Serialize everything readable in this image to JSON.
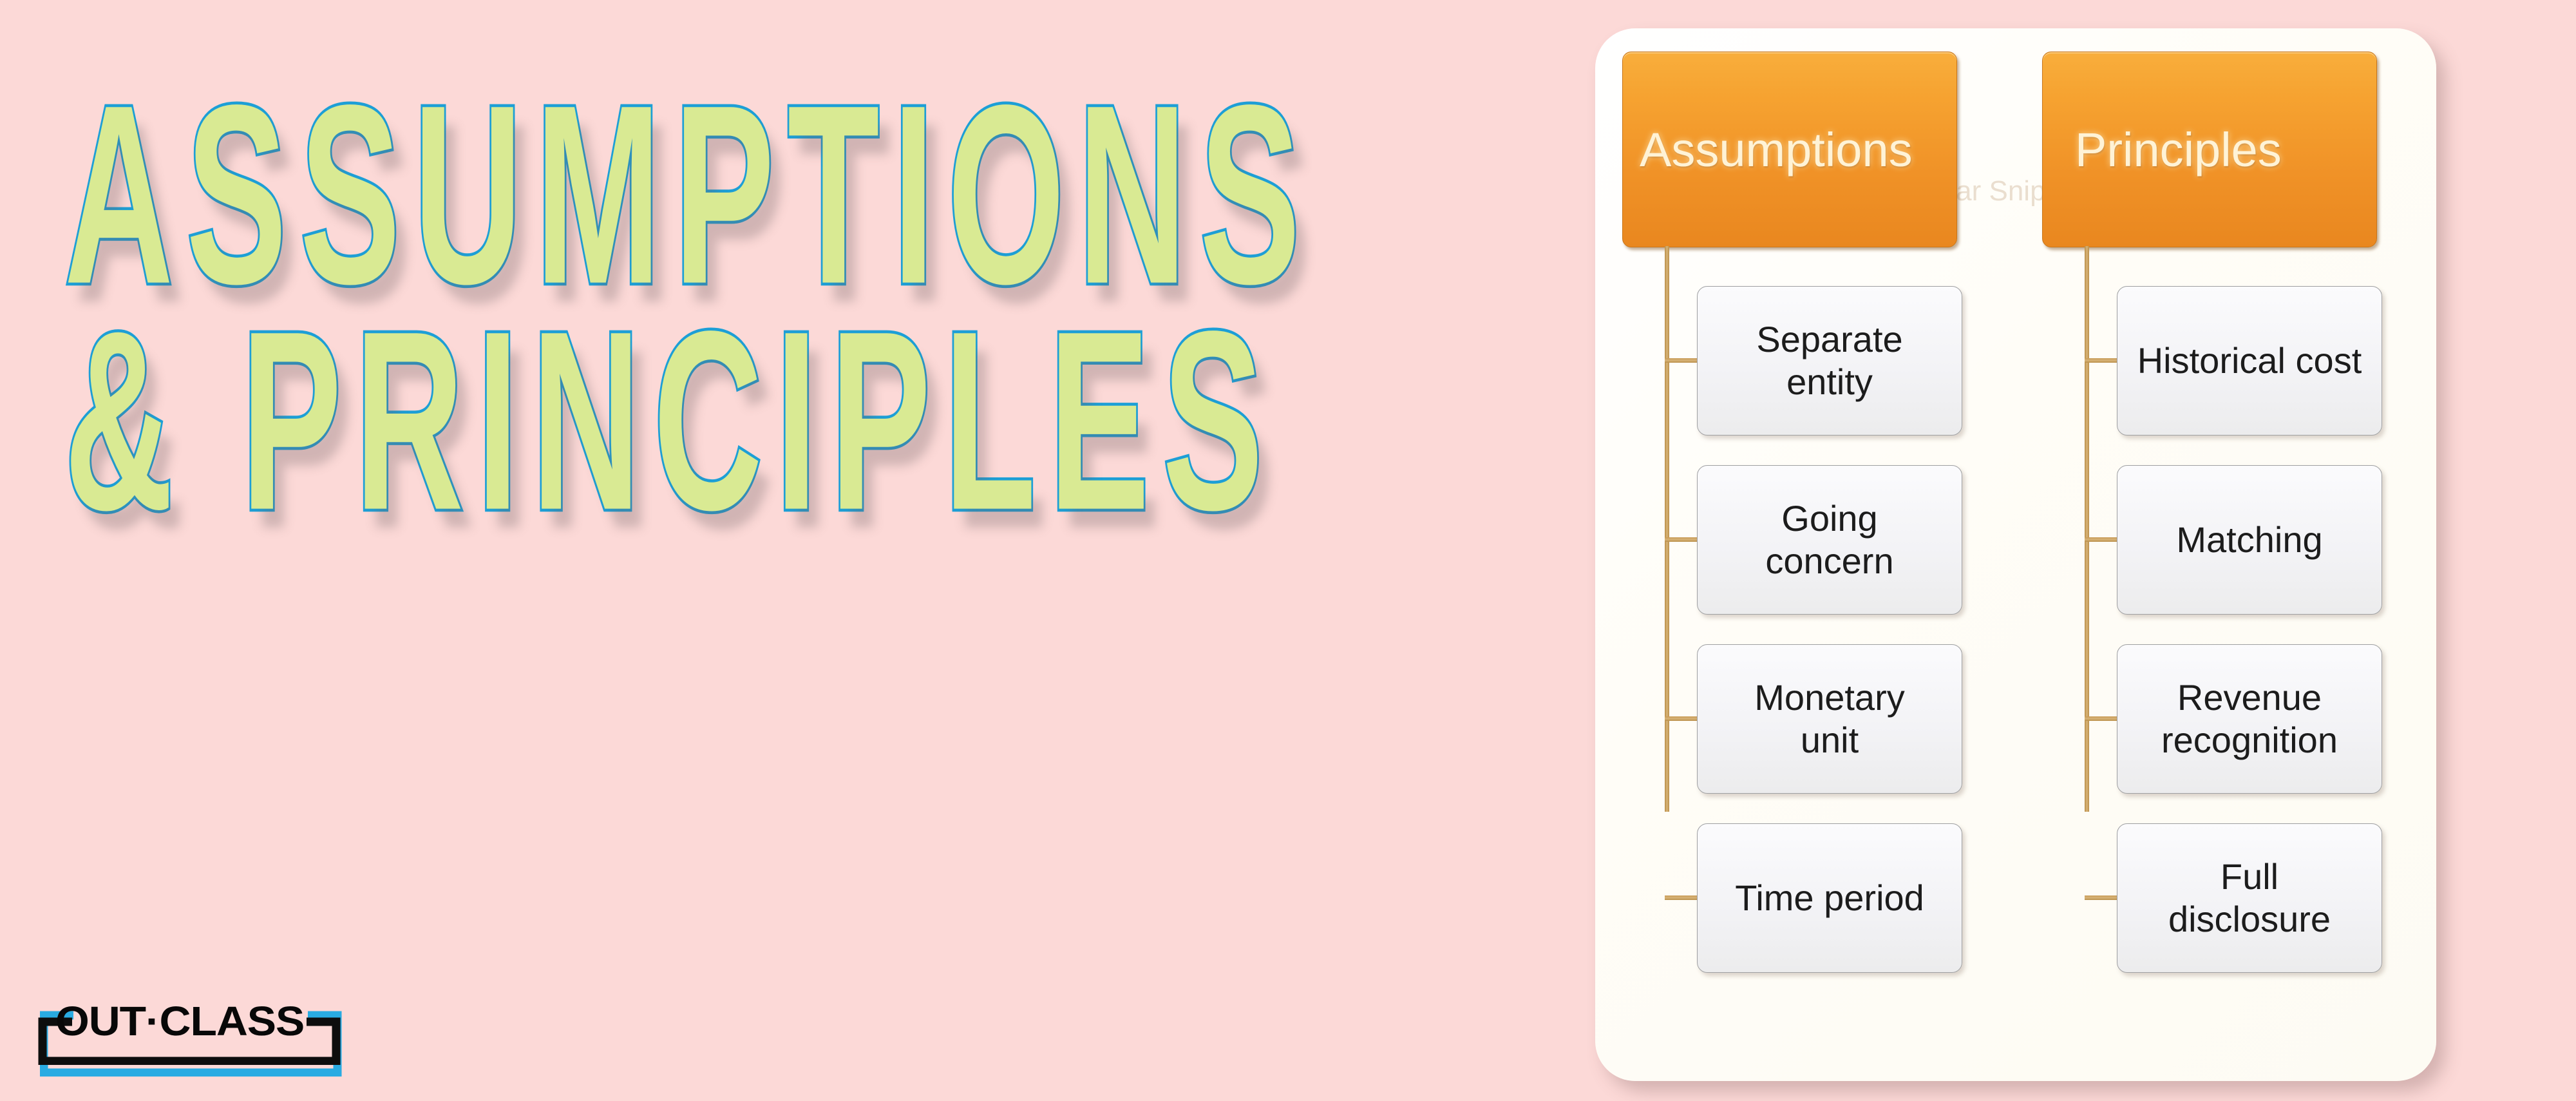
{
  "page": {
    "background_color": "#fcd9d7"
  },
  "title": {
    "line1": "ASSUMPTIONS",
    "line2": "& PRINCIPLES",
    "fill_color": "#d9ea93",
    "outline_color": "#1d9fd6"
  },
  "logo": {
    "word": "OUT·CLASS",
    "bracket_color_primary": "#0d0d0d",
    "bracket_color_accent": "#29abe2"
  },
  "diagram": {
    "card_background": "#ffffff",
    "header_color": "#f09227",
    "header_text_color": "#fff3d6",
    "connector_color": "#c69a56",
    "watermark": "Rectangular Snip",
    "columns": [
      {
        "header": "Assumptions",
        "items": [
          {
            "line1": "Separate",
            "line2": "entity"
          },
          {
            "line1": "Going",
            "line2": "concern"
          },
          {
            "line1": "Monetary",
            "line2": "unit"
          },
          {
            "line1": "Time period",
            "line2": ""
          }
        ]
      },
      {
        "header": "Principles",
        "items": [
          {
            "line1": "Historical cost",
            "line2": ""
          },
          {
            "line1": "Matching",
            "line2": ""
          },
          {
            "line1": "Revenue",
            "line2": "recognition"
          },
          {
            "line1": "Full",
            "line2": "disclosure"
          }
        ]
      }
    ]
  }
}
